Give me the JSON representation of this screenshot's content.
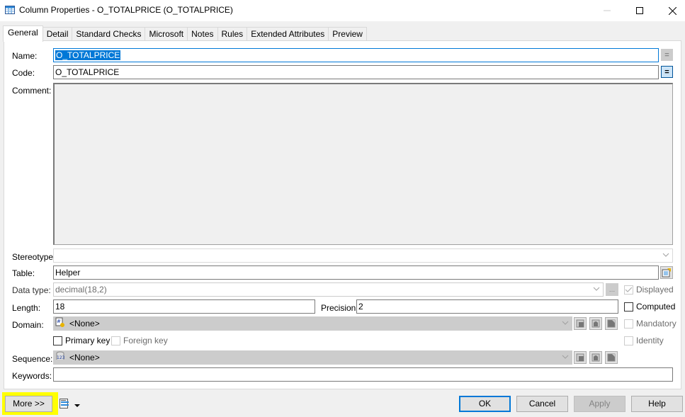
{
  "window": {
    "title": "Column Properties - O_TOTALPRICE (O_TOTALPRICE)",
    "icon": "table-column-icon",
    "controls": [
      "minimize-icon",
      "maximize-icon",
      "close-icon"
    ]
  },
  "tabs": [
    {
      "label": "General",
      "active": true
    },
    {
      "label": "Detail",
      "active": false
    },
    {
      "label": "Standard Checks",
      "active": false
    },
    {
      "label": "Microsoft",
      "active": false
    },
    {
      "label": "Notes",
      "active": false
    },
    {
      "label": "Rules",
      "active": false
    },
    {
      "label": "Extended Attributes",
      "active": false
    },
    {
      "label": "Preview",
      "active": false
    }
  ],
  "form": {
    "name": {
      "label": "Name:",
      "value": "O_TOTALPRICE",
      "selected": true
    },
    "code": {
      "label": "Code:",
      "value": "O_TOTALPRICE"
    },
    "equals_symbol": "=",
    "comment": {
      "label": "Comment:",
      "value": ""
    },
    "stereotype": {
      "label": "Stereotype:",
      "value": ""
    },
    "table": {
      "label": "Table:",
      "value": "Helper"
    },
    "data_type": {
      "label": "Data type:",
      "value": "decimal(18,2)",
      "browse_label": "..."
    },
    "length": {
      "label": "Length:",
      "value": "18"
    },
    "precision": {
      "label": "Precision:",
      "value": "2"
    },
    "domain": {
      "label": "Domain:",
      "value": "<None>"
    },
    "sequence": {
      "label": "Sequence:",
      "value": "<None>"
    },
    "keywords": {
      "label": "Keywords:",
      "value": ""
    },
    "checkboxes": {
      "displayed": {
        "label": "Displayed",
        "checked": true,
        "enabled": false
      },
      "computed": {
        "label": "Computed",
        "checked": false,
        "enabled": true
      },
      "mandatory": {
        "label": "Mandatory",
        "checked": false,
        "enabled": false
      },
      "identity": {
        "label": "Identity",
        "checked": false,
        "enabled": false
      },
      "primary_key": {
        "label": "Primary key",
        "checked": false,
        "enabled": true
      },
      "foreign_key": {
        "label": "Foreign key",
        "checked": false,
        "enabled": false
      }
    }
  },
  "footer": {
    "more": "More >>",
    "ok": "OK",
    "cancel": "Cancel",
    "apply": "Apply",
    "help": "Help"
  },
  "colors": {
    "accent": "#0078d7",
    "highlight": "#ffff00",
    "disabled_field": "#cccccc"
  }
}
